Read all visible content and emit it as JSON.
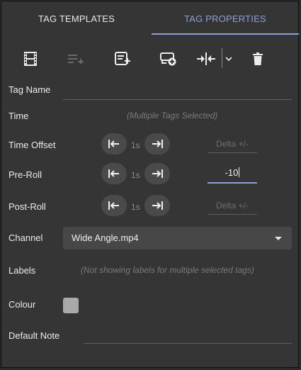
{
  "tabs": {
    "templates": "TAG TEMPLATES",
    "properties": "TAG PROPERTIES"
  },
  "toolbar": {
    "icons": [
      "film-icon",
      "add-to-list-icon",
      "note-add-icon",
      "add-clip-icon",
      "merge-icon",
      "chevron-down-icon",
      "delete-icon"
    ]
  },
  "fields": {
    "tag_name": {
      "label": "Tag Name",
      "value": ""
    },
    "time": {
      "label": "Time",
      "hint": "(Multiple Tags Selected)"
    },
    "time_offset": {
      "label": "Time Offset",
      "unit": "1s",
      "placeholder": "Delta +/-"
    },
    "pre_roll": {
      "label": "Pre-Roll",
      "unit": "1s",
      "value": "-10"
    },
    "post_roll": {
      "label": "Post-Roll",
      "unit": "1s",
      "placeholder": "Delta +/-"
    },
    "channel": {
      "label": "Channel",
      "value": "Wide Angle.mp4"
    },
    "labels": {
      "label": "Labels",
      "hint": "(Not showing labels for multiple selected tags)"
    },
    "colour": {
      "label": "Colour",
      "swatch": "#a9a9a9"
    },
    "default_note": {
      "label": "Default Note",
      "value": ""
    }
  },
  "colors": {
    "accent": "#8f9fd8",
    "panel": "#353535",
    "button": "#4a4a4a"
  }
}
